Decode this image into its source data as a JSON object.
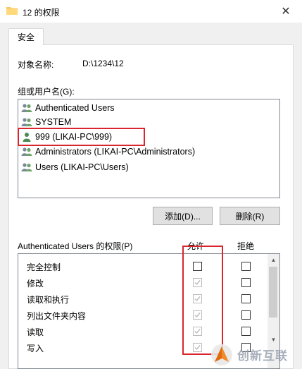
{
  "window": {
    "title": "12 的权限",
    "close_glyph": "✕"
  },
  "tabs": [
    {
      "label": "安全"
    }
  ],
  "object": {
    "label": "对象名称:",
    "value": "D:\\1234\\12"
  },
  "groups": {
    "label": "组或用户名(G):",
    "items": [
      {
        "label": "Authenticated Users",
        "icon": "users-group-icon"
      },
      {
        "label": "SYSTEM",
        "icon": "users-group-icon"
      },
      {
        "label": "999 (LIKAI-PC\\999)",
        "icon": "single-user-icon",
        "highlighted": true
      },
      {
        "label": "Administrators (LIKAI-PC\\Administrators)",
        "icon": "users-group-icon"
      },
      {
        "label": "Users (LIKAI-PC\\Users)",
        "icon": "users-group-icon"
      }
    ]
  },
  "buttons": {
    "add": "添加(D)...",
    "remove": "删除(R)"
  },
  "permissions": {
    "header": "Authenticated Users 的权限(P)",
    "allow_label": "允许",
    "deny_label": "拒绝",
    "rows": [
      {
        "name": "完全控制",
        "allow": false,
        "allow_disabled": false,
        "deny": false
      },
      {
        "name": "修改",
        "allow": true,
        "allow_disabled": true,
        "deny": false
      },
      {
        "name": "读取和执行",
        "allow": true,
        "allow_disabled": true,
        "deny": false
      },
      {
        "name": "列出文件夹内容",
        "allow": true,
        "allow_disabled": true,
        "deny": false
      },
      {
        "name": "读取",
        "allow": true,
        "allow_disabled": true,
        "deny": false
      },
      {
        "name": "写入",
        "allow": true,
        "allow_disabled": true,
        "deny": false
      }
    ]
  },
  "watermark": {
    "text": "创新互联"
  },
  "colors": {
    "highlight": "#d9262e",
    "accent": "#0078d7"
  }
}
